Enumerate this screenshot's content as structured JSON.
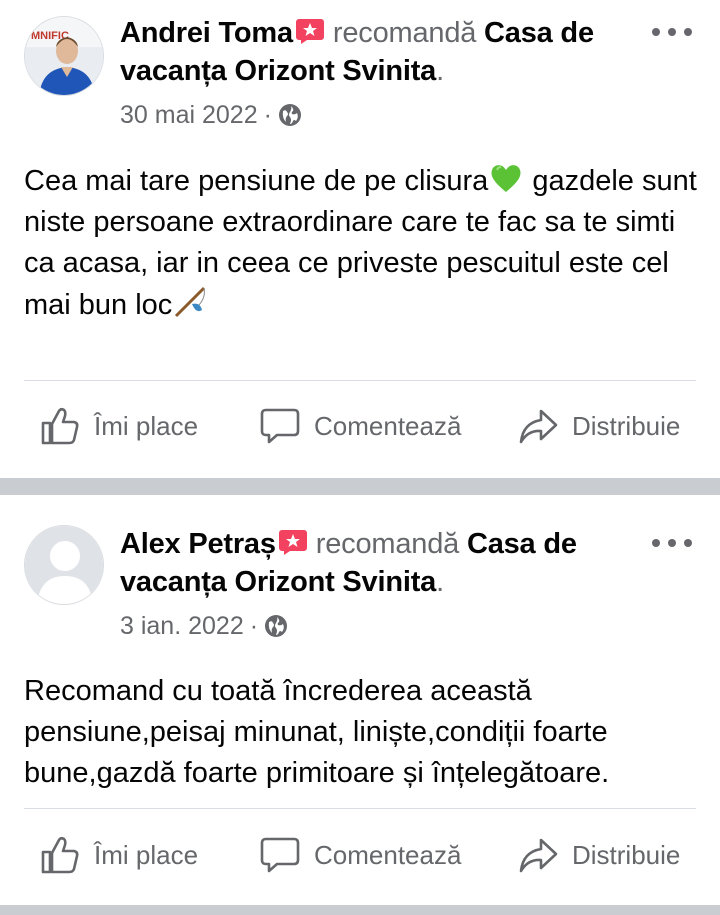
{
  "posts": [
    {
      "author": "Andrei Toma",
      "verb": "recomandă",
      "page": "Casa de vacanța Orizont Svinita",
      "date": "30 mai 2022",
      "separator": "·",
      "text": "Cea mai tare pensiune de pe clisura",
      "text_line2": " gazdele sunt niste persoane extraordinare care te fac sa te simti ca acasa, iar in ceea ce priveste pescuitul este cel mai bun loc",
      "emoji1": "green-heart-emoji",
      "emoji2": "fishing-pole-emoji",
      "avatar_text": "MNIFIC"
    },
    {
      "author": "Alex Petraș",
      "verb": "recomandă",
      "page": "Casa de vacanța Orizont Svinita",
      "date": "3 ian. 2022",
      "separator": "·",
      "text": "Recomand cu toată încrederea această pensiune,peisaj minunat, liniște,condiții foarte bune,gazdă foarte primitoare și înțelegătoare."
    }
  ],
  "actions": {
    "like": "Îmi place",
    "comment": "Comentează",
    "share": "Distribuie"
  },
  "colors": {
    "secondary_text": "#65676b",
    "recommend_badge": "#f3425f",
    "separator": "#c9ccd1"
  }
}
